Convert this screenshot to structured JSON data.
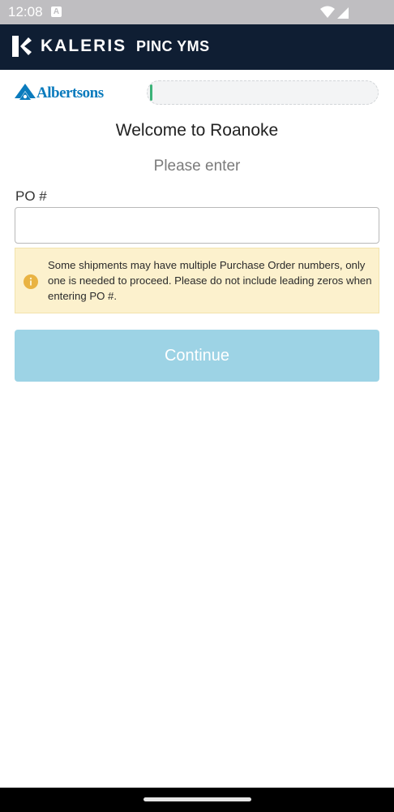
{
  "status_bar": {
    "time": "12:08",
    "notification_badge": "A",
    "icons": [
      "wifi-icon",
      "cellular-signal-icon"
    ]
  },
  "header": {
    "brand": "KALERIS",
    "product": "PINC YMS",
    "background_color": "#0f1e33"
  },
  "client": {
    "logo_text": "Albertsons",
    "brand_color": "#0a7bbd"
  },
  "progress": {
    "fraction": 0.012,
    "fill_color": "#3bb278"
  },
  "main": {
    "welcome": "Welcome to Roanoke",
    "instruction": "Please enter",
    "po_label": "PO #",
    "po_value": "",
    "po_placeholder": "",
    "notice": "Some shipments may have multiple Purchase Order numbers, only one is needed to proceed. Please do not include leading zeros when entering PO #.",
    "continue_label": "Continue"
  },
  "colors": {
    "notice_background": "#fcf1cd",
    "info_icon": "#e9b342",
    "continue_button": "#9dd3e5"
  }
}
